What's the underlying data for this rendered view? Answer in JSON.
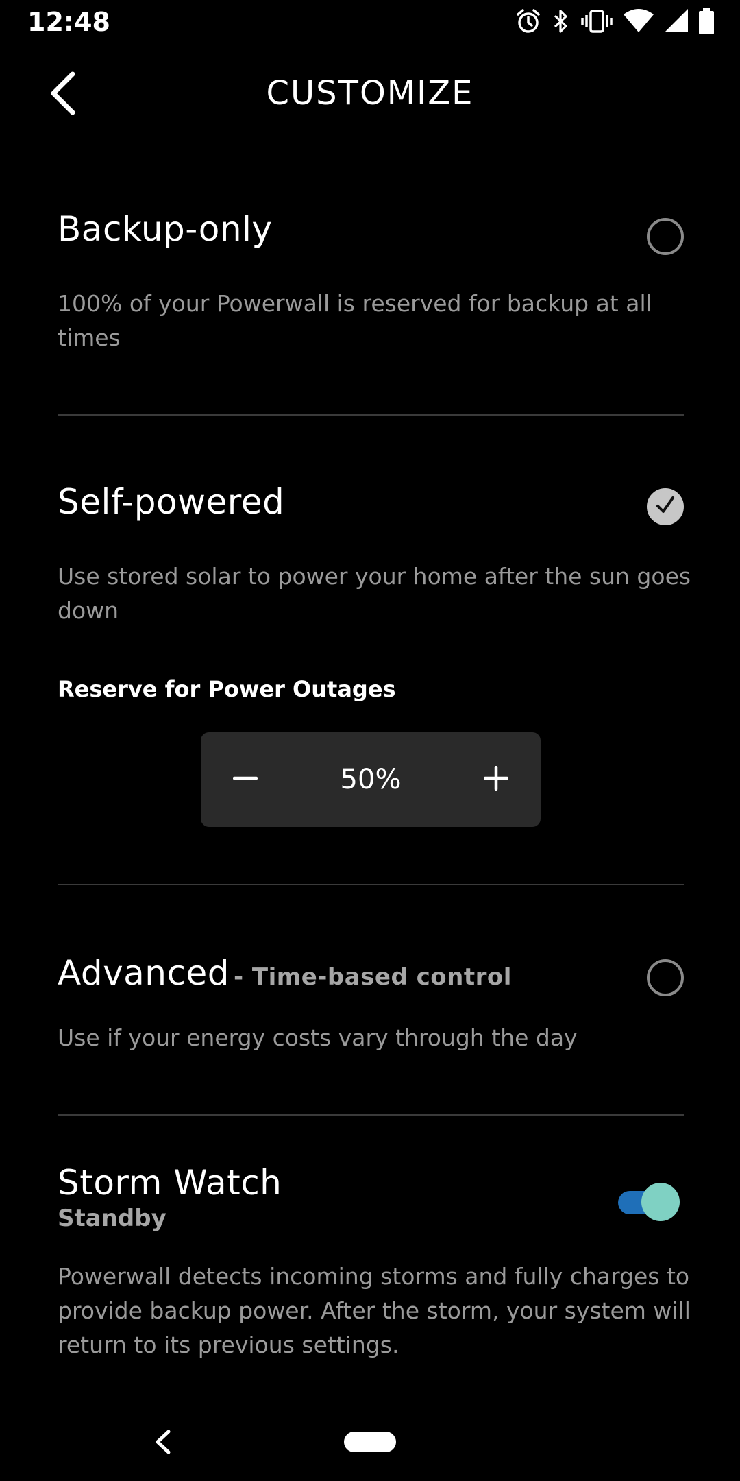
{
  "status_bar": {
    "time": "12:48",
    "icons": [
      "alarm-icon",
      "bluetooth-icon",
      "vibrate-icon",
      "wifi-icon",
      "signal-icon",
      "battery-icon"
    ]
  },
  "header": {
    "title": "CUSTOMIZE",
    "back_icon": "chevron-left-icon"
  },
  "options": {
    "backup_only": {
      "title": "Backup-only",
      "description": "100% of your Powerwall is reserved for backup at all times",
      "selected": false
    },
    "self_powered": {
      "title": "Self-powered",
      "description": "Use stored solar to power your home after the sun goes down",
      "selected": true,
      "reserve_label": "Reserve for Power Outages",
      "reserve_value": "50%",
      "minus_symbol": "minus-icon",
      "plus_symbol": "plus-icon"
    },
    "advanced": {
      "title": "Advanced",
      "subtitle": "- Time-based control",
      "description": "Use if your energy costs vary through the day",
      "selected": false
    }
  },
  "storm_watch": {
    "title": "Storm Watch",
    "status": "Standby",
    "description": "Powerwall detects incoming storms and fully charges to provide backup power. After the storm, your system will return to its previous settings.",
    "enabled": true
  },
  "colors": {
    "background": "#000000",
    "text_primary": "#ffffff",
    "text_secondary": "#9a9a9a",
    "divider": "#3a3a3a",
    "stepper_bg": "#2a2a2a",
    "toggle_track": "#1f6fb8",
    "toggle_knob": "#7fd1c3"
  },
  "nav_bar": {
    "back_icon": "nav-back-icon",
    "home_icon": "nav-home-pill"
  }
}
